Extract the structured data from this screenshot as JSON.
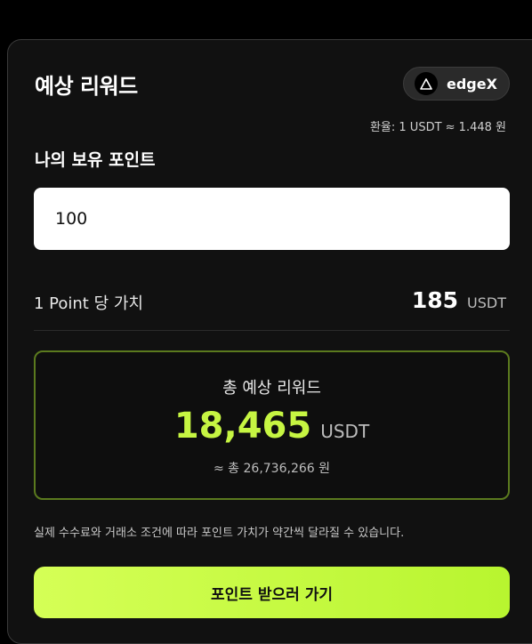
{
  "card": {
    "title": "예상 리워드",
    "badge": {
      "icon": "edgex-logo-icon",
      "label": "edgeX"
    },
    "exchange_rate": "환율: 1 USDT ≈ 1.448 원"
  },
  "points": {
    "label": "나의 보유 포인트",
    "value": "100"
  },
  "per_point": {
    "label": "1 Point 당 가치",
    "value": "185",
    "unit": "USDT"
  },
  "total": {
    "label": "총 예상 리워드",
    "value": "18,465",
    "unit": "USDT",
    "krw": "≈ 총 26,736,266 원"
  },
  "disclaimer": "실제 수수료와 거래소 조건에 따라 포인트 가치가 약간씩 달라질 수 있습니다.",
  "cta_label": "포인트 받으러 가기",
  "colors": {
    "accent": "#c6f542",
    "background": "#111111",
    "border_accent": "#5b7a1e"
  }
}
